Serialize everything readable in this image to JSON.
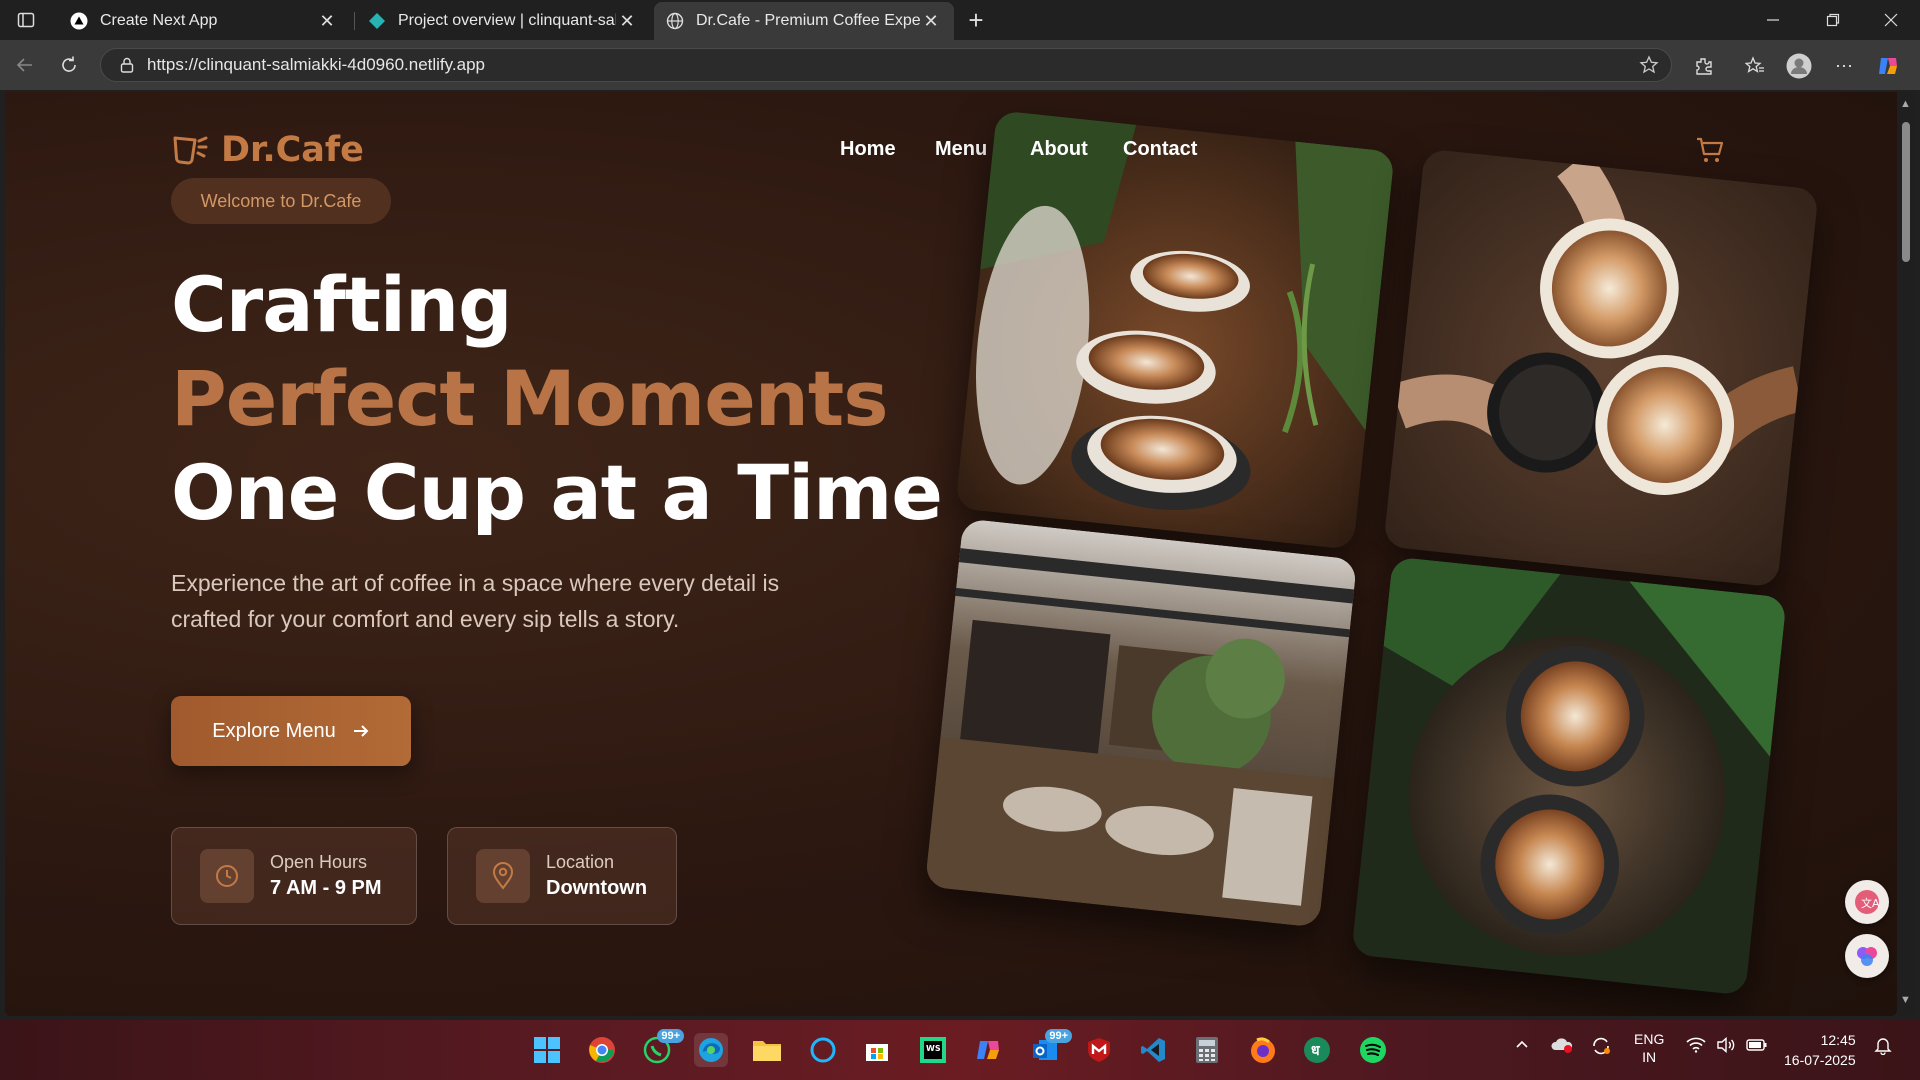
{
  "browser": {
    "tabs": [
      {
        "title": "Create Next App",
        "active": false
      },
      {
        "title": "Project overview | clinquant-salm",
        "active": false
      },
      {
        "title": "Dr.Cafe - Premium Coffee Experie",
        "active": true
      }
    ],
    "url": "https://clinquant-salmiakki-4d0960.netlify.app"
  },
  "site": {
    "brand": "Dr.Cafe",
    "welcome": "Welcome to Dr.Cafe",
    "nav": [
      "Home",
      "Menu",
      "About",
      "Contact"
    ],
    "hero": {
      "line1": "Crafting",
      "line2": "Perfect Moments",
      "line3": "One Cup at a Time"
    },
    "lead": "Experience the art of coffee in a space where every detail is crafted for your comfort and every sip tells a story.",
    "cta_label": "Explore Menu",
    "info": [
      {
        "label": "Open Hours",
        "value": "7 AM - 9 PM",
        "icon": "clock-icon"
      },
      {
        "label": "Location",
        "value": "Downtown",
        "icon": "map-pin-icon"
      }
    ],
    "colors": {
      "accent": "#b87446",
      "background": "#2b1710"
    }
  },
  "taskbar": {
    "badges": [
      "99+",
      "99+"
    ],
    "lang": [
      "ENG",
      "IN"
    ],
    "time": "12:45",
    "date": "16-07-2025"
  }
}
